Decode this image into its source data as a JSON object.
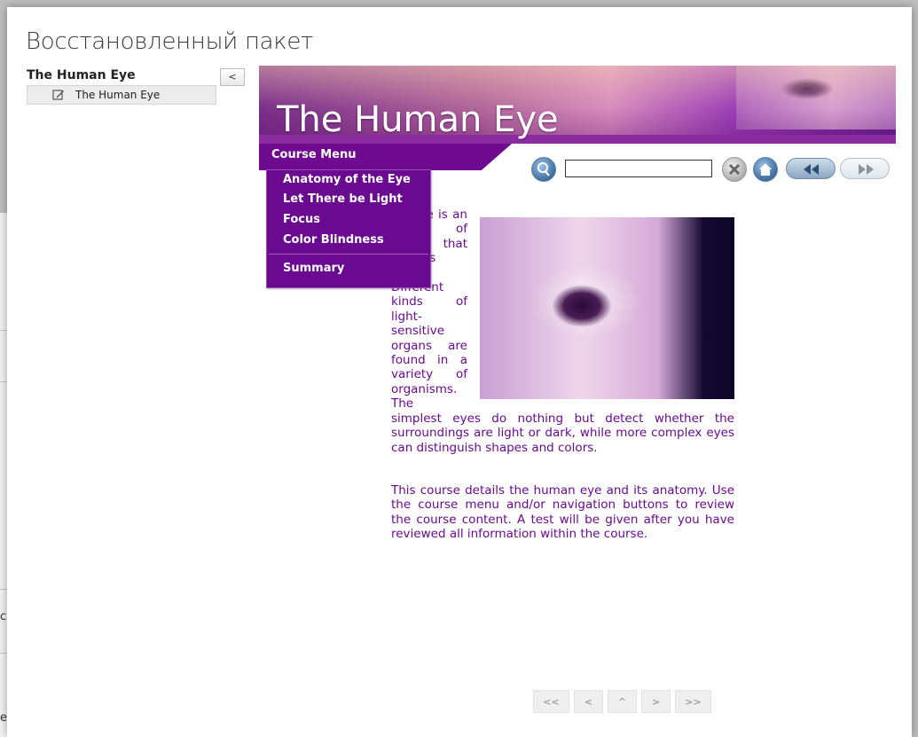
{
  "window": {
    "title": "Восстановленный пакет"
  },
  "background": {
    "fragment_1": "са",
    "fragment_2": "ен"
  },
  "toc": {
    "heading": "The Human Eye",
    "collapse_label": "<",
    "items": [
      {
        "label": "The Human Eye",
        "icon": "edit-icon"
      }
    ]
  },
  "course": {
    "banner_title": "The Human Eye",
    "menu_label": "Course Menu",
    "menu_items": [
      "Anatomy of the Eye",
      "Let There be Light",
      "Focus",
      "Color Blindness"
    ],
    "menu_summary": "Summary",
    "toolbar": {
      "search_value": "",
      "icons": [
        "search-magnifier-icon",
        "clear-x-icon",
        "home-icon",
        "rewind-icon",
        "fast-forward-icon"
      ]
    },
    "paragraph_1": "An eye is an organ of vision that detects light. Different kinds of light-sensitive organs are found in a variety of organisms. The simplest eyes do nothing but detect whether the surroundings are light or dark, while more complex eyes can distinguish shapes and colors.",
    "paragraph_2": "This course details the human eye and its anatomy. Use the course menu and/or navigation buttons to review the course content. A test will be given after you have reviewed all information within the course."
  },
  "pager": {
    "first": "<<",
    "prev": "<",
    "up": "^",
    "next": ">",
    "last": ">>"
  },
  "colors": {
    "accent": "#6a0a91",
    "menu_bg": "#6d0a8f",
    "text": "#6a0a91"
  }
}
